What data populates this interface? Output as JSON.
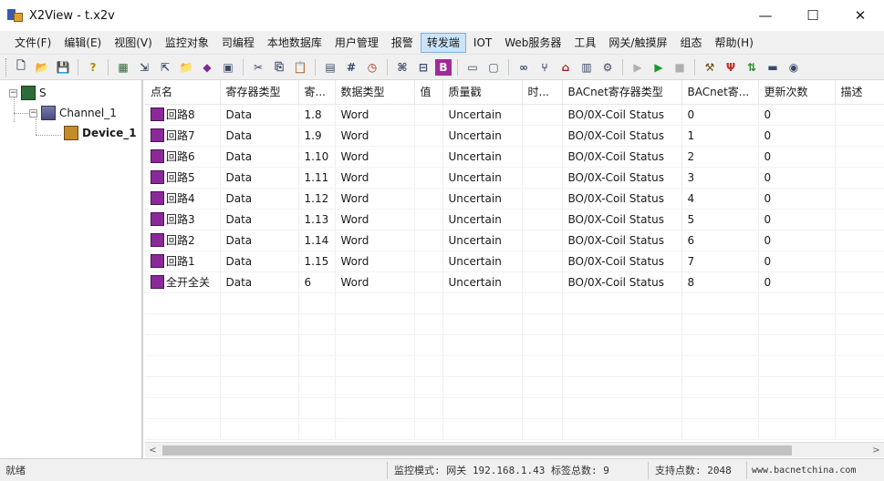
{
  "window": {
    "title": "X2View - t.x2v",
    "minimize": "—",
    "maximize": "☐",
    "close": "✕"
  },
  "menu": [
    "文件(F)",
    "编辑(E)",
    "视图(V)",
    "监控对象",
    "司编程",
    "本地数据库",
    "用户管理",
    "报警",
    "转发端",
    "IOT",
    "Web服务器",
    "工具",
    "网关/触摸屏",
    "组态",
    "帮助(H)"
  ],
  "menu_active_index": 8,
  "toolbar": {
    "icons": [
      "new-file-icon",
      "open-folder-icon",
      "save-icon",
      "help-icon",
      "table-icon",
      "import-icon",
      "export-icon",
      "folder-add-icon",
      "cube-icon",
      "image-icon",
      "cut-icon",
      "copy-icon",
      "paste-icon",
      "chart-icon",
      "grid-icon",
      "clock-icon",
      "tag-icon",
      "label-icon",
      "bold-b-icon",
      "window-icon",
      "monitor-icon",
      "link-icon",
      "fork-icon",
      "home-icon",
      "device-icon",
      "gear-icon",
      "play-disabled-icon",
      "run-icon",
      "stop-icon",
      "tools-icon",
      "plugin-icon",
      "network-icon",
      "terminal-icon",
      "globe-icon"
    ],
    "bold_b_label": "B"
  },
  "tree": {
    "root_label": "S",
    "channel_label": "Channel_1",
    "device_label": "Device_1",
    "collapse_symbol": "−"
  },
  "table": {
    "columns": [
      "点名",
      "寄存器类型",
      "寄...",
      "数据类型",
      "值",
      "质量戳",
      "时...",
      "BACnet寄存器类型",
      "BACnet寄...",
      "更新次数",
      "描述"
    ],
    "rows": [
      [
        "回路8",
        "Data",
        "1.8",
        "Word",
        "",
        "Uncertain",
        "",
        "BO/0X-Coil Status",
        "0",
        "0",
        ""
      ],
      [
        "回路7",
        "Data",
        "1.9",
        "Word",
        "",
        "Uncertain",
        "",
        "BO/0X-Coil Status",
        "1",
        "0",
        ""
      ],
      [
        "回路6",
        "Data",
        "1.10",
        "Word",
        "",
        "Uncertain",
        "",
        "BO/0X-Coil Status",
        "2",
        "0",
        ""
      ],
      [
        "回路5",
        "Data",
        "1.11",
        "Word",
        "",
        "Uncertain",
        "",
        "BO/0X-Coil Status",
        "3",
        "0",
        ""
      ],
      [
        "回路4",
        "Data",
        "1.12",
        "Word",
        "",
        "Uncertain",
        "",
        "BO/0X-Coil Status",
        "4",
        "0",
        ""
      ],
      [
        "回路3",
        "Data",
        "1.13",
        "Word",
        "",
        "Uncertain",
        "",
        "BO/0X-Coil Status",
        "5",
        "0",
        ""
      ],
      [
        "回路2",
        "Data",
        "1.14",
        "Word",
        "",
        "Uncertain",
        "",
        "BO/0X-Coil Status",
        "6",
        "0",
        ""
      ],
      [
        "回路1",
        "Data",
        "1.15",
        "Word",
        "",
        "Uncertain",
        "",
        "BO/0X-Coil Status",
        "7",
        "0",
        ""
      ],
      [
        "全开全关",
        "Data",
        "6",
        "Word",
        "",
        "Uncertain",
        "",
        "BO/0X-Coil Status",
        "8",
        "0",
        ""
      ]
    ]
  },
  "scrollbar": {
    "left_arrow": "<",
    "right_arrow": ">"
  },
  "status": {
    "ready": "就绪",
    "monitor_mode": "监控模式: 网关 192.168.1.43 标签总数: 9",
    "support_points": "支持点数: 2048",
    "website": "www.bacnetchina.com"
  },
  "colors": {
    "menu_active_bg": "#cce4f7",
    "row_icon": "#8a2a9a",
    "run_green": "#1a9a2a"
  }
}
